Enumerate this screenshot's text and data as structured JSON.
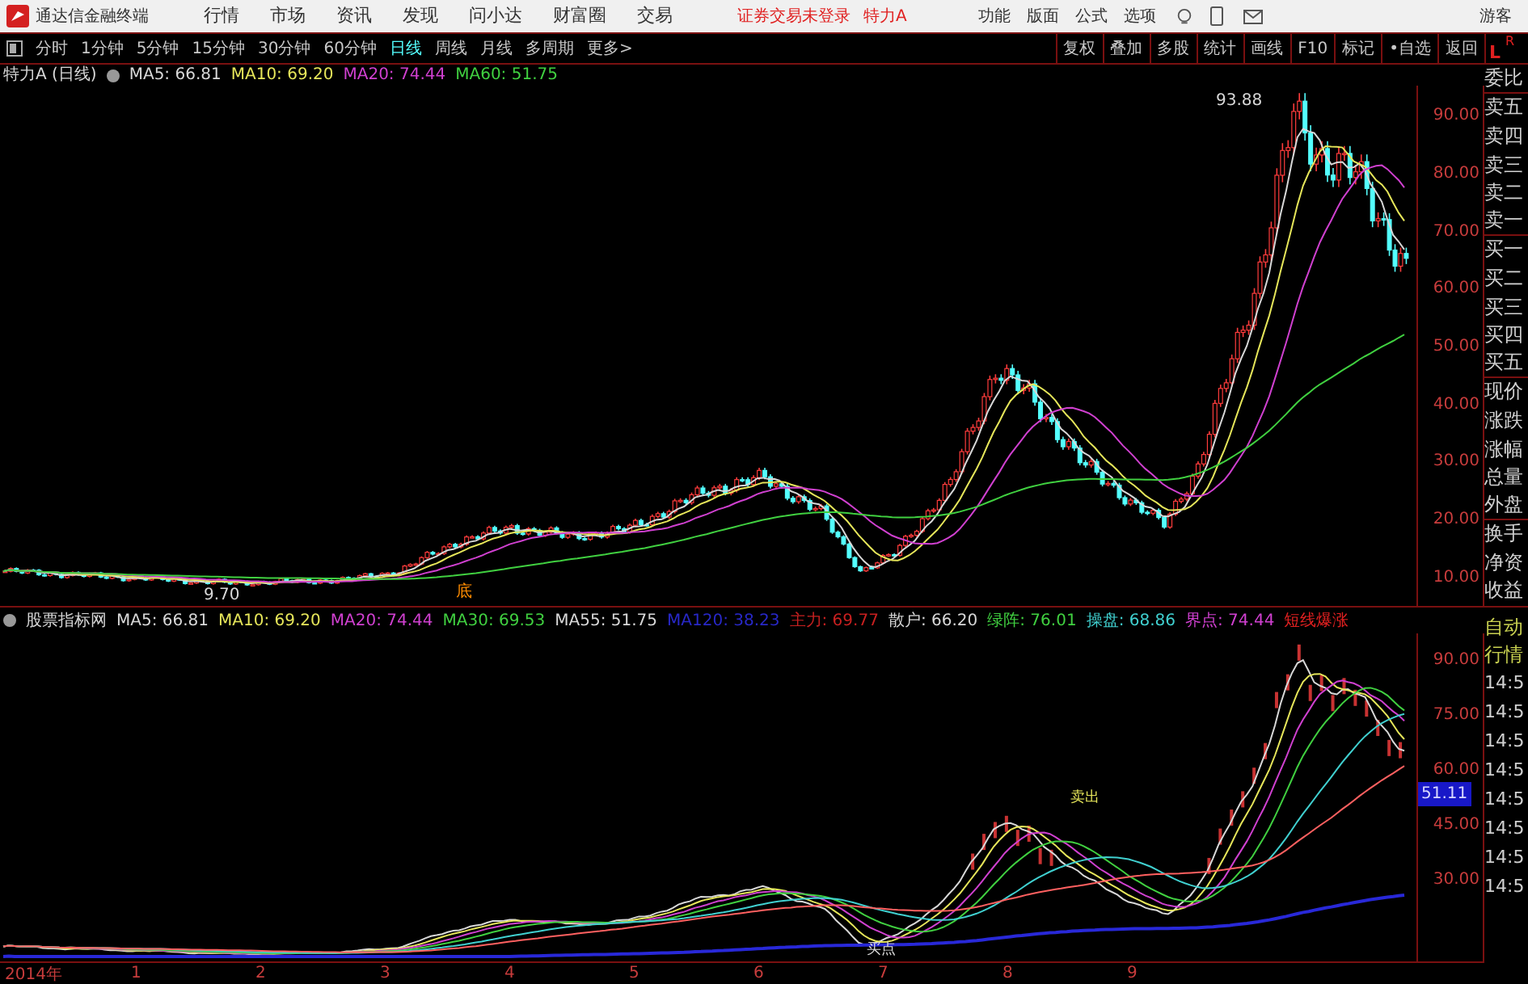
{
  "title_bar": {
    "app_name": "通达信金融终端",
    "menus": [
      "行情",
      "市场",
      "资讯",
      "发现",
      "问小达",
      "财富圈",
      "交易"
    ],
    "notice": "证券交易未登录",
    "stock": "特力A",
    "tools": [
      "功能",
      "版面",
      "公式",
      "选项"
    ],
    "user": "游客"
  },
  "period_bar": {
    "periods": [
      {
        "label": "分时",
        "selected": false
      },
      {
        "label": "1分钟",
        "selected": false
      },
      {
        "label": "5分钟",
        "selected": false
      },
      {
        "label": "15分钟",
        "selected": false
      },
      {
        "label": "30分钟",
        "selected": false
      },
      {
        "label": "60分钟",
        "selected": false
      },
      {
        "label": "日线",
        "selected": true
      },
      {
        "label": "周线",
        "selected": false
      },
      {
        "label": "月线",
        "selected": false
      },
      {
        "label": "多周期",
        "selected": false
      }
    ],
    "more": "更多>",
    "tools": [
      "复权",
      "叠加",
      "多股",
      "统计",
      "画线",
      "F10",
      "标记",
      "•自选",
      "返回"
    ],
    "corner": [
      "L",
      "R"
    ]
  },
  "main_chart": {
    "stock": "特力A",
    "period": "(日线)",
    "indicators": [
      {
        "label": "MA5: 66.81",
        "color": "#d8d8d8"
      },
      {
        "label": "MA10: 69.20",
        "color": "#e6e65a"
      },
      {
        "label": "MA20: 74.44",
        "color": "#d040d0"
      },
      {
        "label": "MA60: 51.75",
        "color": "#40d040"
      }
    ],
    "high_label": "93.88",
    "low_label": "9.70",
    "marker": "底",
    "y_ticks": [
      "90.00",
      "80.00",
      "70.00",
      "60.00",
      "50.00",
      "40.00",
      "30.00",
      "20.00",
      "10.00"
    ]
  },
  "indicator_pane": {
    "name": "股票指标网",
    "indicators": [
      {
        "label": "MA5: 66.81",
        "color": "#d8d8d8"
      },
      {
        "label": "MA10: 69.20",
        "color": "#e6e65a"
      },
      {
        "label": "MA20: 74.44",
        "color": "#d040d0"
      },
      {
        "label": "MA30: 69.53",
        "color": "#40d040"
      },
      {
        "label": "MA55: 51.75",
        "color": "#d8d8d8"
      },
      {
        "label": "MA120: 38.23",
        "color": "#2828c8"
      },
      {
        "label": "主力: 69.77",
        "color": "#c82020"
      },
      {
        "label": "散户: 66.20",
        "color": "#d8d8d8"
      },
      {
        "label": "绿阵: 76.01",
        "color": "#40d040"
      },
      {
        "label": "操盘: 68.86",
        "color": "#40d0d0"
      },
      {
        "label": "界点: 74.44",
        "color": "#d040d0"
      },
      {
        "label": "短线爆涨",
        "color": "#e02020"
      }
    ],
    "signals": [
      "卖出",
      "买点"
    ],
    "y_ticks": [
      "90.00",
      "75.00",
      "60.00",
      "45.00",
      "30.00"
    ],
    "last_value": "51.11"
  },
  "date_axis": [
    "2014年",
    "1",
    "2",
    "3",
    "4",
    "5",
    "6",
    "7",
    "8",
    "9"
  ],
  "quote_panel": {
    "rows": [
      "委比",
      "卖五",
      "卖四",
      "卖三",
      "卖二",
      "卖一",
      "买一",
      "买二",
      "买三",
      "买四",
      "买五",
      "现价",
      "涨跌",
      "涨幅",
      "总量",
      "外盘",
      "换手",
      "净资",
      "收益"
    ],
    "auto": [
      "自动",
      "行情"
    ],
    "times": [
      "14:5",
      "14:5",
      "14:5",
      "14:5",
      "14:5",
      "14:5",
      "14:5",
      "14:5"
    ]
  }
}
